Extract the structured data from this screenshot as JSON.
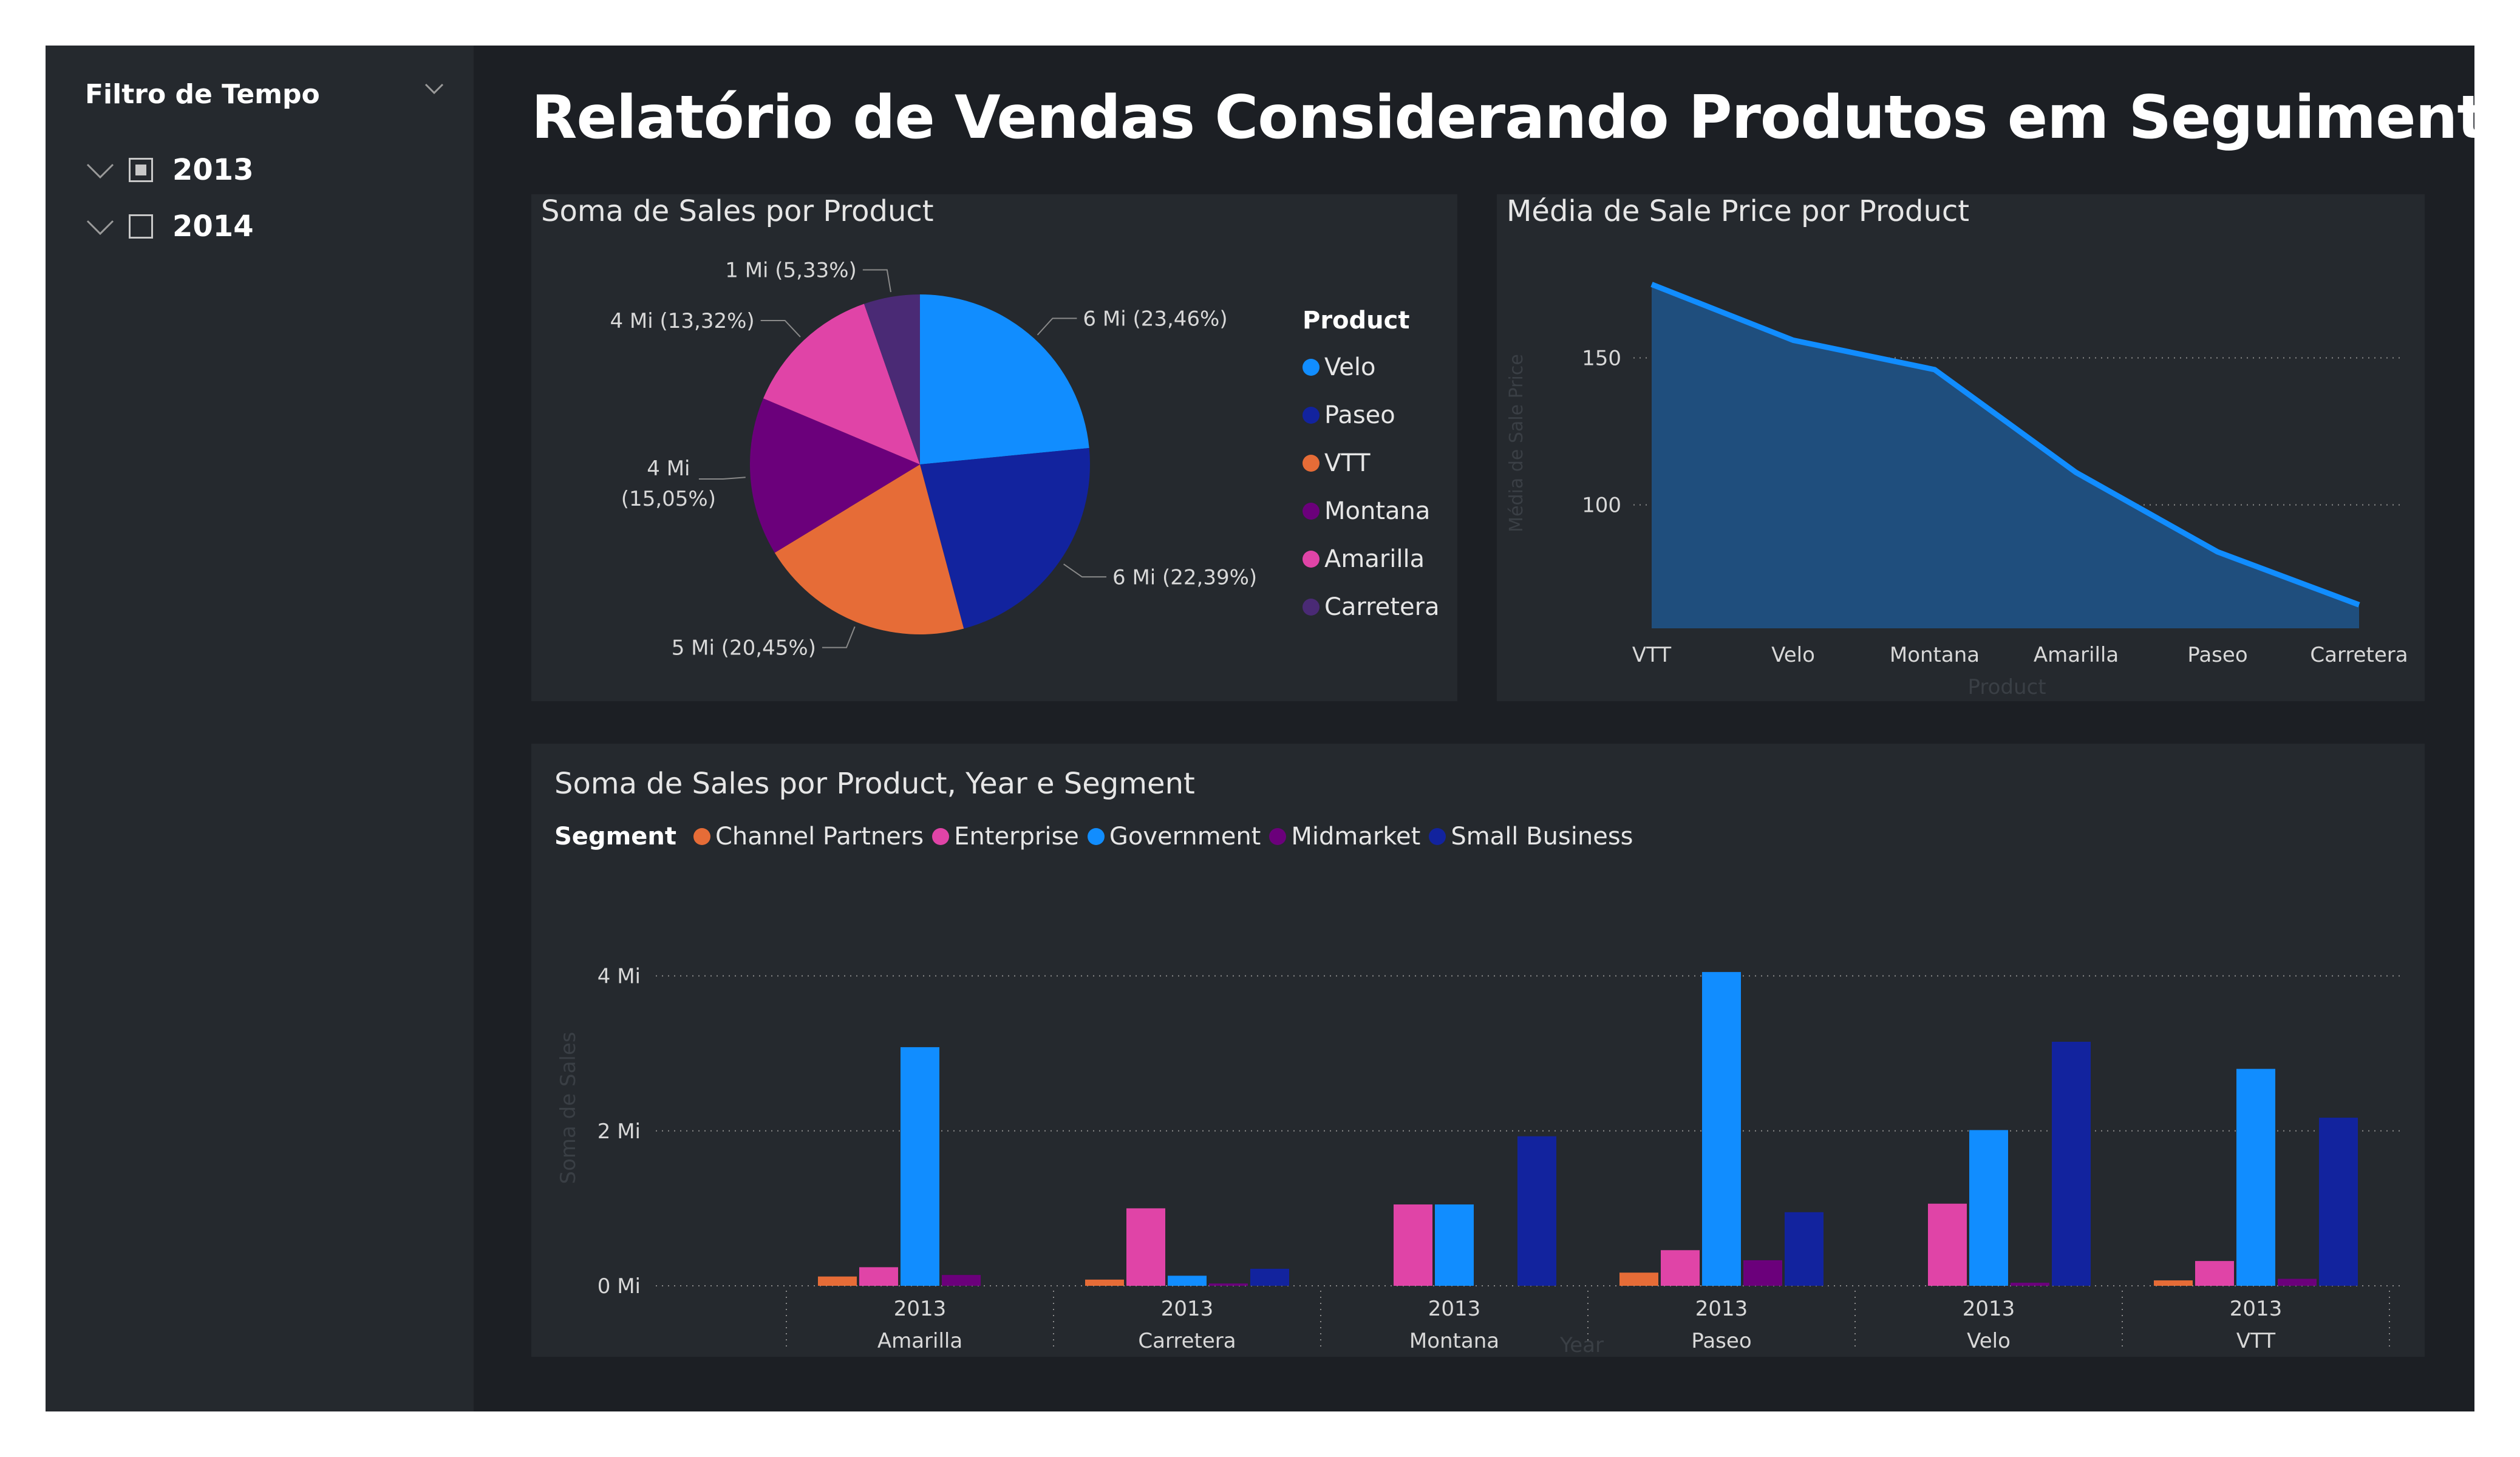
{
  "slicer": {
    "title": "Filtro de Tempo",
    "items": [
      {
        "label": "2013",
        "state": "partial"
      },
      {
        "label": "2014",
        "state": "unchecked"
      }
    ]
  },
  "page_title": "Relatório de Vendas Considerando Produtos em Seguimento",
  "colors": {
    "background": "#1c1f24",
    "panel": "#25292e",
    "Velo": "#118dff",
    "Paseo": "#12239e",
    "VTT": "#e66c37",
    "Montana": "#6b007b",
    "Amarilla": "#e044a7",
    "Carretera": "#4a2a75",
    "Channel Partners": "#e66c37",
    "Enterprise": "#e044a7",
    "Government": "#118dff",
    "Midmarket": "#6b007b",
    "Small Business": "#12239e",
    "area_line": "#118dff",
    "area_fill": "#1f4e7d"
  },
  "chart_data": [
    {
      "type": "pie",
      "title": "Soma de Sales por Product",
      "legend_title": "Product",
      "legend_position": "right",
      "slices": [
        {
          "label": "Velo",
          "percent": 23.46,
          "data_label": "6 Mi (23,46%)"
        },
        {
          "label": "Paseo",
          "percent": 22.39,
          "data_label": "6 Mi (22,39%)"
        },
        {
          "label": "VTT",
          "percent": 20.45,
          "data_label": "5 Mi (20,45%)"
        },
        {
          "label": "Montana",
          "percent": 15.05,
          "data_label": "4 Mi (15,05%)"
        },
        {
          "label": "Amarilla",
          "percent": 13.32,
          "data_label": "4 Mi (13,32%)"
        },
        {
          "label": "Carretera",
          "percent": 5.33,
          "data_label": "1 Mi (5,33%)"
        }
      ]
    },
    {
      "type": "area",
      "title": "Média de Sale Price por Product",
      "xlabel": "Product",
      "ylabel": "Média de Sale Price",
      "categories": [
        "VTT",
        "Velo",
        "Montana",
        "Amarilla",
        "Paseo",
        "Carretera"
      ],
      "values": [
        175,
        156,
        146,
        111,
        84,
        66
      ],
      "yticks": [
        100,
        150
      ],
      "ylim": [
        58,
        185
      ],
      "grid": true
    },
    {
      "type": "bar",
      "title": "Soma de Sales por Product, Year e Segment",
      "legend_title": "Segment",
      "legend_position": "top-left",
      "xlabel": "Year",
      "ylabel": "Soma de Sales",
      "ytick_labels": [
        "0 Mi",
        "2 Mi",
        "4 Mi"
      ],
      "yticks": [
        0,
        2,
        4
      ],
      "ylim": [
        0,
        4.2
      ],
      "grid": true,
      "groups": [
        {
          "year": "2013",
          "product": "Amarilla"
        },
        {
          "year": "2013",
          "product": "Carretera"
        },
        {
          "year": "2013",
          "product": "Montana"
        },
        {
          "year": "2013",
          "product": "Paseo"
        },
        {
          "year": "2013",
          "product": "Velo"
        },
        {
          "year": "2013",
          "product": "VTT"
        }
      ],
      "series": [
        {
          "name": "Channel Partners",
          "values": [
            0.12,
            0.08,
            0,
            0.17,
            0,
            0.07
          ]
        },
        {
          "name": "Enterprise",
          "values": [
            0.24,
            1.0,
            1.05,
            0.46,
            1.06,
            0.32
          ]
        },
        {
          "name": "Government",
          "values": [
            3.08,
            0.13,
            1.05,
            4.05,
            2.01,
            2.8
          ]
        },
        {
          "name": "Midmarket",
          "values": [
            0.14,
            0.03,
            0,
            0.33,
            0.04,
            0.09
          ]
        },
        {
          "name": "Small Business",
          "values": [
            0,
            0.22,
            1.93,
            0.95,
            3.15,
            2.17
          ]
        }
      ]
    }
  ]
}
